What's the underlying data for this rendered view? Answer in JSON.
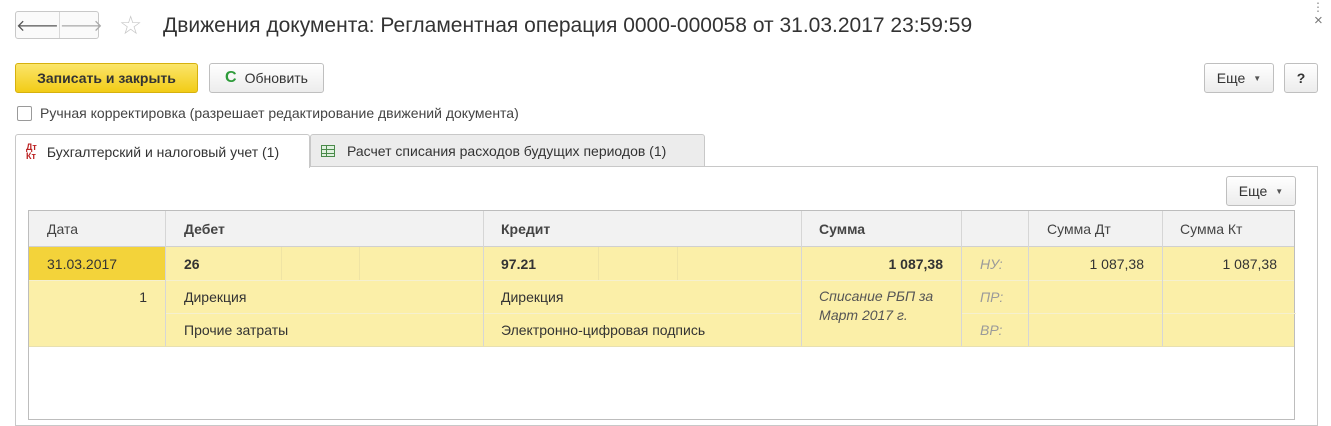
{
  "window": {
    "title": "Движения документа: Регламентная операция 0000-000058 от 31.03.2017 23:59:59",
    "more_glyph": "⋮",
    "close_glyph": "×"
  },
  "nav": {
    "back_glyph": "🡐",
    "forward_glyph": "🡒",
    "star_glyph": "☆"
  },
  "toolbar": {
    "save_close": "Записать и закрыть",
    "refresh": "Обновить",
    "refresh_glyph": "C",
    "more": "Еще",
    "help": "?",
    "caret": "▼"
  },
  "manual_edit": {
    "label": "Ручная корректировка (разрешает редактирование движений документа)",
    "checked": false
  },
  "tabs": [
    {
      "label": "Бухгалтерский и налоговый учет (1)",
      "icon": "dt-kt-icon",
      "icon_top": "Дт",
      "icon_bottom": "Кт",
      "active": true
    },
    {
      "label": "Расчет списания расходов будущих периодов (1)",
      "icon": "grid-icon",
      "active": false
    }
  ],
  "panel": {
    "more": "Еще",
    "caret": "▼"
  },
  "table": {
    "columns": [
      "Дата",
      "Дебет",
      "Кредит",
      "Сумма",
      "",
      "Сумма Дт",
      "Сумма Кт"
    ],
    "row": {
      "date": "31.03.2017",
      "number": "1",
      "debit_account": "26",
      "debit_sub1": "Дирекция",
      "debit_sub2": "Прочие затраты",
      "credit_account": "97.21",
      "credit_sub1": "Дирекция",
      "credit_sub2": "Электронно-цифровая подпись",
      "amount": "1 087,38",
      "content_line1": "Списание РБП за",
      "content_line2": "Март 2017 г.",
      "nu_label": "НУ:",
      "pr_label": "ПР:",
      "vr_label": "ВР:",
      "amount_dt": "1 087,38",
      "amount_kt": "1 087,38"
    },
    "highlight_color": "#fbefa8",
    "selected_color": "#f3d33a"
  }
}
